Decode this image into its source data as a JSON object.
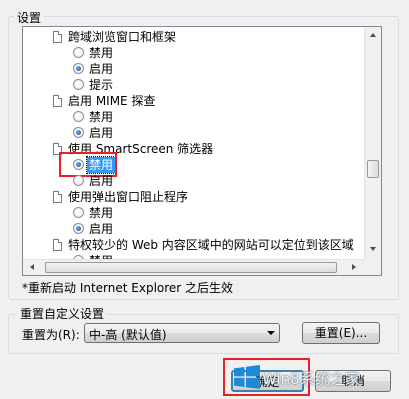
{
  "settings_group": {
    "label": "设置"
  },
  "list_items": [
    {
      "kind": "header",
      "text": "跨域浏览窗口和框架"
    },
    {
      "kind": "radio",
      "text": "禁用",
      "checked": false
    },
    {
      "kind": "radio",
      "text": "启用",
      "checked": true
    },
    {
      "kind": "radio",
      "text": "提示",
      "checked": false
    },
    {
      "kind": "header",
      "text": "启用 MIME 探查"
    },
    {
      "kind": "radio",
      "text": "禁用",
      "checked": false
    },
    {
      "kind": "radio",
      "text": "启用",
      "checked": true
    },
    {
      "kind": "header",
      "text": "使用 SmartScreen 筛选器"
    },
    {
      "kind": "radio",
      "text": "禁用",
      "checked": true,
      "selected": true
    },
    {
      "kind": "radio",
      "text": "启用",
      "checked": false
    },
    {
      "kind": "header",
      "text": "使用弹出窗口阻止程序"
    },
    {
      "kind": "radio",
      "text": "禁用",
      "checked": false
    },
    {
      "kind": "radio",
      "text": "启用",
      "checked": true
    },
    {
      "kind": "header",
      "text": "特权较少的 Web 内容区域中的网站可以定位到该区域"
    },
    {
      "kind": "radio",
      "text": "禁用",
      "checked": false
    }
  ],
  "restart_note": "*重新启动 Internet Explorer 之后生效",
  "reset_group": {
    "label": "重置自定义设置",
    "reset_to_label": "重置为(R):",
    "combo_value": "中-高 (默认值)",
    "reset_button": "重置(E)..."
  },
  "footer": {
    "ok_button": "确定",
    "cancel_button": "取消"
  },
  "watermark": {
    "text": "Win8系统之家"
  },
  "colors": {
    "selection": "#3399ff",
    "highlight_border": "#e8202a",
    "windows_logo": "#1e8ad6"
  }
}
